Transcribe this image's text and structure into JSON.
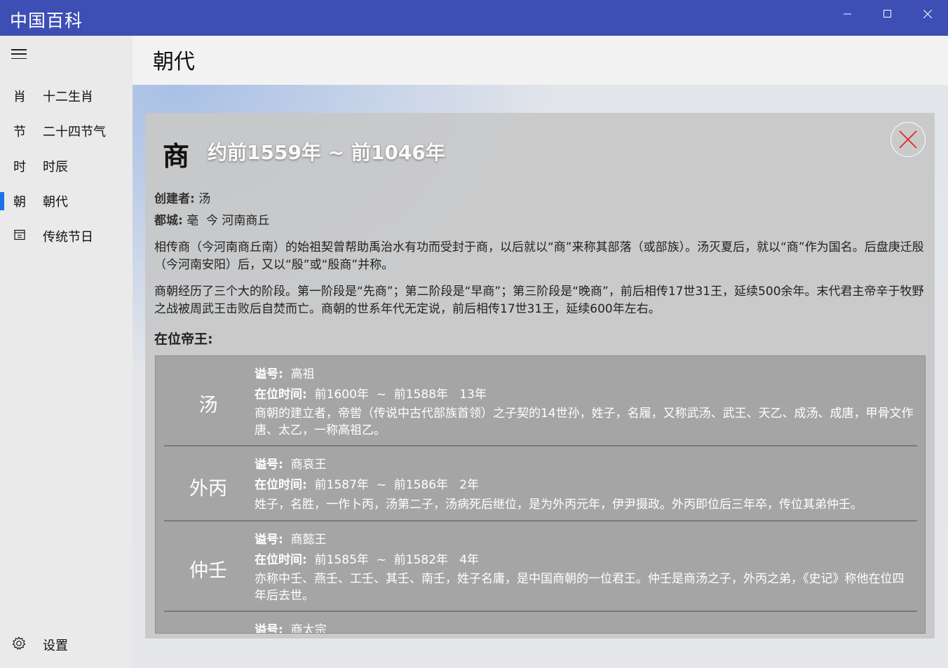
{
  "app": {
    "title": "中国百科"
  },
  "window": {
    "minimize": "minimize-icon",
    "maximize": "maximize-icon",
    "close": "close-icon"
  },
  "sidebar": {
    "items": [
      {
        "icon": "肖",
        "label": "十二生肖",
        "active": false
      },
      {
        "icon": "节",
        "label": "二十四节气",
        "active": false
      },
      {
        "icon": "时",
        "label": "时辰",
        "active": false
      },
      {
        "icon": "朝",
        "label": "朝代",
        "active": true
      },
      {
        "icon": "calendar-icon",
        "label": "传统节日",
        "active": false
      }
    ],
    "settings_label": "设置"
  },
  "header": {
    "page_title": "朝代"
  },
  "dynasty": {
    "name": "商",
    "period": "约前1559年 ~ 前1046年",
    "founder_key": "创建者:",
    "founder": "汤",
    "capital_key": "都城:",
    "capital": "亳  今 河南商丘",
    "para1": "相传商（今河南商丘南）的始祖契曾帮助禹治水有功而受封于商，以后就以“商”来称其部落（或部族）。汤灭夏后，就以“商”作为国名。后盘庚迁殷（今河南安阳）后，又以“殷”或“殷商”并称。",
    "para2": "商朝经历了三个大的阶段。第一阶段是“先商”；第二阶段是“早商”；第三阶段是“晚商”，前后相传17世31王，延续500余年。末代君主帝辛于牧野之战被周武王击败后自焚而亡。商朝的世系年代无定说，前后相传17世31王，延续600年左右。",
    "emperors_title": "在位帝王:"
  },
  "labels": {
    "posthumous": "谥号:",
    "reign": "在位时间:"
  },
  "emperors": [
    {
      "name": "汤",
      "posthumous": "高祖",
      "reign": "前1600年  ~  前1588年   13年",
      "desc": "商朝的建立者，帝喾（传说中古代部族首领）之子契的14世孙，姓子，名履，又称武汤、武王、天乙、成汤、成唐，甲骨文作唐、太乙，一称高祖乙。"
    },
    {
      "name": "外丙",
      "posthumous": "商哀王",
      "reign": "前1587年  ~  前1586年   2年",
      "desc": "姓子，名胜，一作卜丙，汤第二子，汤病死后继位，是为外丙元年，伊尹摄政。外丙即位后三年卒，传位其弟仲壬。"
    },
    {
      "name": "仲壬",
      "posthumous": "商懿王",
      "reign": "前1585年  ~  前1582年   4年",
      "desc": "亦称中壬、燕壬、工壬、其壬、南壬，姓子名庸，是中国商朝的一位君王。仲壬是商汤之子，外丙之弟，《史记》称他在位四年后去世。"
    },
    {
      "name": "",
      "posthumous": "商太宗",
      "reign": "",
      "desc": ""
    }
  ]
}
